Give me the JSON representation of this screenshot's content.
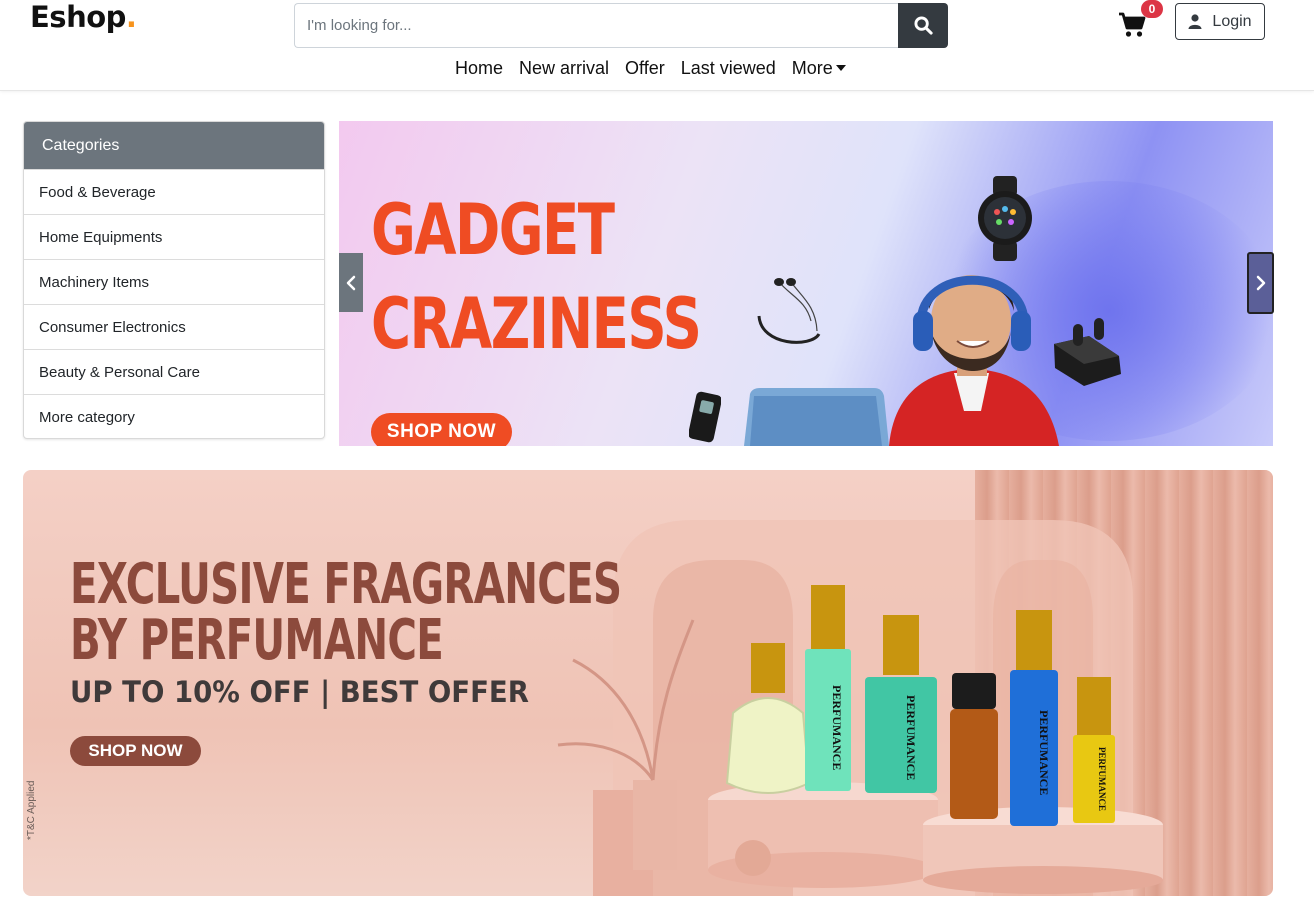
{
  "header": {
    "logo_text": "Eshop",
    "logo_dot": ".",
    "search_placeholder": "I'm looking for...",
    "cart_count": "0",
    "login_label": "Login",
    "nav": [
      "Home",
      "New arrival",
      "Offer",
      "Last viewed",
      "More"
    ]
  },
  "categories": {
    "title": "Categories",
    "items": [
      "Food & Beverage",
      "Home Equipments",
      "Machinery Items",
      "Consumer Electronics",
      "Beauty & Personal Care",
      "More category"
    ]
  },
  "carousel": {
    "title_line1": "GADGET",
    "title_line2": "CRAZINESS",
    "cta": "SHOP NOW"
  },
  "promo": {
    "title_line1": "EXCLUSIVE FRAGRANCES",
    "title_line2": "BY PERFUMANCE",
    "subtitle": "UP TO 10% OFF | BEST OFFER",
    "cta": "SHOP NOW",
    "disclaimer": "*T&C Applied",
    "bottle_brand": "PERFUMANCE"
  },
  "colors": {
    "accent": "#f7941d",
    "dark": "#343a40",
    "badge": "#dc3545",
    "gadget_red": "#ef4c23",
    "perfume_brown": "#8c4a3c"
  }
}
